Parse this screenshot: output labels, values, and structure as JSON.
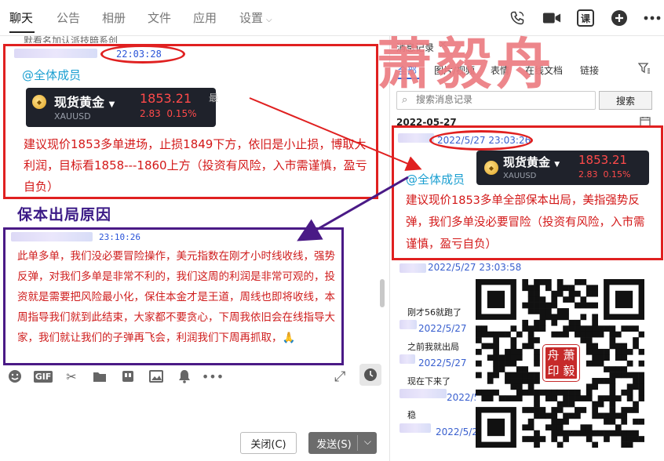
{
  "nav": {
    "tabs": [
      {
        "label": "聊天",
        "active": true
      },
      {
        "label": "公告"
      },
      {
        "label": "相册"
      },
      {
        "label": "文件"
      },
      {
        "label": "应用"
      },
      {
        "label": "设置"
      }
    ],
    "actions": [
      {
        "icon": "phone-icon"
      },
      {
        "icon": "video-icon"
      },
      {
        "icon": "class-icon",
        "label": "课"
      },
      {
        "icon": "plus-icon"
      },
      {
        "icon": "more-icon"
      }
    ]
  },
  "chat": {
    "clipped_text": "默看名加认派技暗系创",
    "message1": {
      "time": "22:03:28",
      "mention": "@全体成员",
      "card": {
        "name": "现货黄金",
        "symbol": "XAUUSD",
        "price": "1853.21",
        "change": "2.83",
        "change_pct": "0.15%",
        "partial": "最"
      },
      "text": "建议现价1853多单进场，止损1849下方，依旧是小止损，博取大利润，目标看1858---1860上方（投资有风险，入市需谨慎，盈亏自负）"
    },
    "annotation_label": "保本出局原因",
    "message2": {
      "time": "23:10:26",
      "text": "此单多单，我们没必要冒险操作，美元指数在刚才小时线收线，强势反弹，对我们多单是非常不利的，我们这周的利润是非常可观的，投资就是需要把风险最小化，保住本金才是王道，周线也即将收线，本周指导我们就到此结束，大家都不要贪心，下周我依旧会在线指导大家，我们就让我们的子弹再飞会，利润我们下周再抓取，",
      "emoji": "🙏"
    }
  },
  "toolbar": {
    "icons": [
      "emoji-icon",
      "gif-icon",
      "scissors-icon",
      "folder-icon",
      "quote-icon",
      "image-icon",
      "bell-icon",
      "more-dots-icon"
    ],
    "gif_label": "GIF",
    "close_label": "关闭(C)",
    "send_label": "发送(S)"
  },
  "history": {
    "title": "消息记录",
    "close": "✕",
    "filters": [
      "全部",
      "图片/视频",
      "表情",
      "在线文档",
      "链接"
    ],
    "search_placeholder": "搜索消息记录",
    "search_button": "搜索",
    "date": "2022-05-27",
    "entry1": {
      "time": "2022/5/27 23:03:26",
      "mention": "@全体成员",
      "card": {
        "name": "现货黄金",
        "symbol": "XAUUSD",
        "price": "1853.21",
        "change": "2.83",
        "change_pct": "0.15%"
      },
      "text": "建议现价1853多单全部保本出局，美指强势反弹，我们多单没必要冒险（投资有风险，入市需谨慎，盈亏自负）"
    },
    "items": [
      {
        "time": "2022/5/27 23:03:58"
      },
      {
        "message": "刚才56就跑了"
      },
      {
        "time": "2022/5/27"
      },
      {
        "message": "之前我就出局"
      },
      {
        "time": "2022/5/27"
      },
      {
        "message": "现在下来了"
      },
      {
        "time": "2022/5/27"
      },
      {
        "message": "稳"
      },
      {
        "time": "2022/5/27"
      }
    ]
  },
  "watermark": "萧毅舟",
  "seal_chars": [
    "舟",
    "萧",
    "印",
    "毅"
  ],
  "colors": {
    "annotation_red": "#e02020",
    "annotation_purple": "#4a1a86",
    "message_red": "#d31818",
    "mention_blue": "#1a9fd1",
    "watermark": "#ec7c82"
  }
}
